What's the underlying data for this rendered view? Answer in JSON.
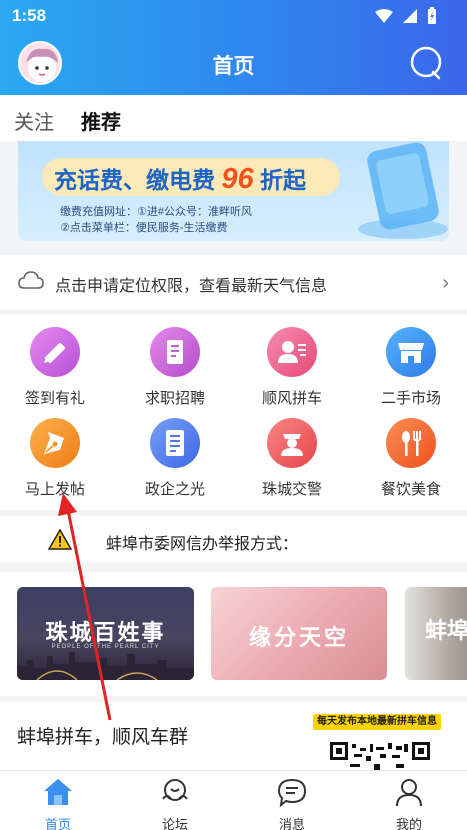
{
  "status_bar": {
    "time": "1:58"
  },
  "header": {
    "title": "首页"
  },
  "tabs": [
    {
      "label": "关注"
    },
    {
      "label": "推荐"
    }
  ],
  "banner": {
    "slogan_prefix": "充话费、缴电费",
    "slogan_number": "96",
    "slogan_suffix": "折起",
    "line1": "缴费充值网址：①进#公众号：淮畔听风",
    "line2": "②点击菜单栏：便民服务-生活缴费"
  },
  "weather": {
    "text": "点击申请定位权限，查看最新天气信息",
    "arrow": "›"
  },
  "grid": {
    "items": [
      {
        "label": "签到有礼",
        "icon": "pen-sign-icon",
        "color": "#c25de0"
      },
      {
        "label": "求职招聘",
        "icon": "document-icon",
        "color": "#c55bd6"
      },
      {
        "label": "顺风拼车",
        "icon": "person-card-icon",
        "color": "#ee5c86"
      },
      {
        "label": "二手市场",
        "icon": "shop-icon",
        "color": "#3a8ef0"
      },
      {
        "label": "马上发帖",
        "icon": "fountain-pen-icon",
        "color": "#f39a1f"
      },
      {
        "label": "政企之光",
        "icon": "list-doc-icon",
        "color": "#4f79ec"
      },
      {
        "label": "珠城交警",
        "icon": "police-icon",
        "color": "#ef5a5d"
      },
      {
        "label": "餐饮美食",
        "icon": "fork-spoon-icon",
        "color": "#f16a2c"
      }
    ]
  },
  "notice": {
    "text": "蚌埠市委网信办举报方式："
  },
  "cards": [
    {
      "title": "珠城百姓事",
      "subtitle": "PEOPLE OF THE PEARL CITY"
    },
    {
      "title": "缘分天空"
    },
    {
      "title": "蚌埠"
    }
  ],
  "post": {
    "title": "蚌埠拼车，顺风车群",
    "badge": "每天发布本地最新拼车信息"
  },
  "bottom_nav": [
    {
      "label": "首页",
      "icon": "home-icon",
      "active": true
    },
    {
      "label": "论坛",
      "icon": "forum-icon",
      "active": false
    },
    {
      "label": "消息",
      "icon": "message-icon",
      "active": false
    },
    {
      "label": "我的",
      "icon": "profile-icon",
      "active": false
    }
  ],
  "colors": {
    "accent": "#2f86ee",
    "annotation_arrow": "#e02424"
  }
}
